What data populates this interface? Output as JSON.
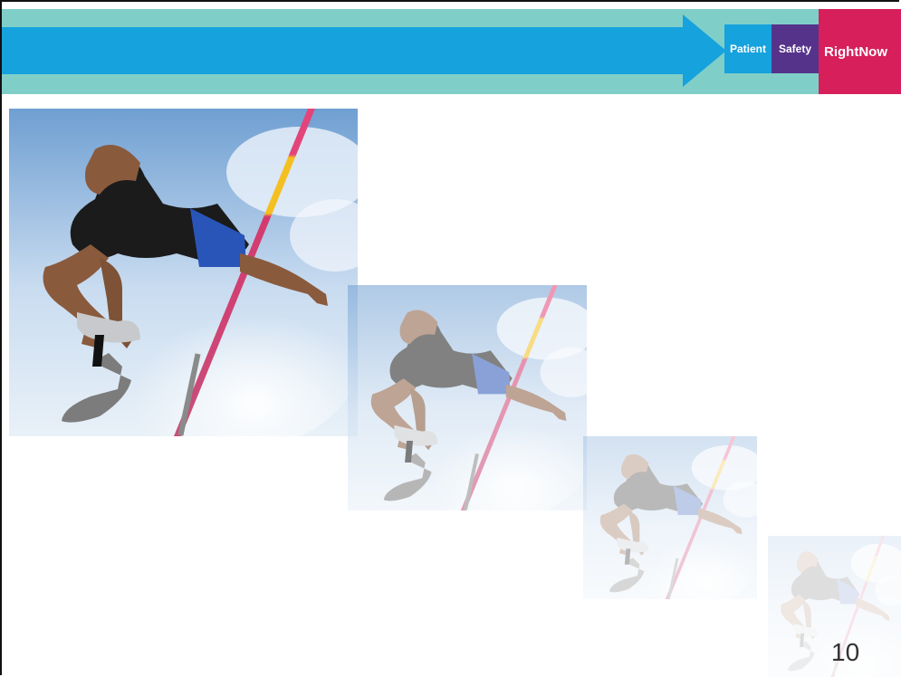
{
  "banner": {
    "patient_label": "Patient",
    "safety_label": "Safety",
    "brand_label": "RightNow"
  },
  "images": [
    {
      "name": "high-jumper-photo",
      "opacity": 1.0
    },
    {
      "name": "high-jumper-photo-faded-1",
      "opacity": 0.55
    },
    {
      "name": "high-jumper-photo-faded-2",
      "opacity": 0.3
    },
    {
      "name": "high-jumper-photo-faded-3",
      "opacity": 0.14
    }
  ],
  "slide": {
    "page_number": "10"
  }
}
